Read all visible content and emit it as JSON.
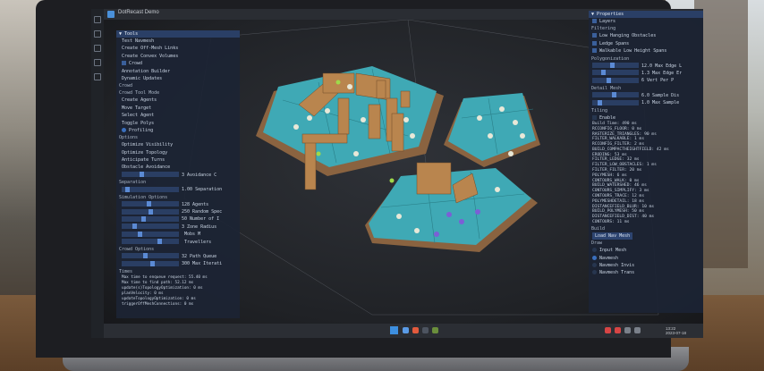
{
  "app": {
    "title": "DotRecast Demo"
  },
  "tools_panel": {
    "header": "Tools",
    "items": [
      {
        "label": "Test Navmesh",
        "kind": "text"
      },
      {
        "label": "Create Off-Mesh Links",
        "kind": "text"
      },
      {
        "label": "Create Convex Volumes",
        "kind": "text"
      },
      {
        "label": "Crowd",
        "kind": "check"
      },
      {
        "label": "Annotation Builder",
        "kind": "text"
      },
      {
        "label": "Dynamic Updates",
        "kind": "text"
      }
    ],
    "crowd_section": "Crowd",
    "crowd_tool_mode": "Crowd Tool Mode",
    "modes": [
      "Create Agents",
      "Move Target",
      "Select Agent",
      "Toggle Polys",
      "Profiling"
    ],
    "options_label": "Options",
    "options": [
      "Optimize Visibility",
      "Optimize Topology",
      "Anticipate Turns",
      "Obstacle Avoidance"
    ],
    "avoidance": {
      "value": "3",
      "label": "Avoidance C"
    },
    "separation_label": "Separation",
    "separation": {
      "value": "1.00",
      "label": "Separation"
    },
    "sim_label": "Simulation Options",
    "sim_rows": [
      {
        "value": "128",
        "label": "Agents"
      },
      {
        "value": "250",
        "label": "Random Spec"
      },
      {
        "value": "50",
        "label": "Number of I"
      },
      {
        "value": "3",
        "label": "Zone Radius"
      },
      {
        "value": "",
        "label": "Mobs M"
      },
      {
        "value": "",
        "label": "Travellers"
      }
    ],
    "crowd_opts_label": "Crowd Options",
    "crowd_opts": [
      {
        "value": "32",
        "label": "Path Queue"
      },
      {
        "value": "300",
        "label": "Max Iterati"
      }
    ],
    "times_label": "Times",
    "times": [
      "Max time to enqueue request: 55.40 ms",
      "Max time to find path: 52.12 ms",
      "update(s)TopologyOptimization: 0 ms",
      "planVelocity: 0 ms",
      "updateTopologyOptimization: 0 ms",
      "triggerOffMeshConnections: 0 ms"
    ]
  },
  "properties_panel": {
    "header": "Properties",
    "top_check": "Layers",
    "filtering_label": "Filtering",
    "filtering": [
      "Low Hanging Obstacles",
      "Ledge Spans",
      "Walkable Low Height Spans"
    ],
    "poly_label": "Polygonization",
    "poly_rows": [
      {
        "value": "12.0",
        "label": "Max Edge L"
      },
      {
        "value": "1.3",
        "label": "Max Edge Er"
      },
      {
        "value": "6",
        "label": "Vert Per P"
      }
    ],
    "detail_label": "Detail Mesh",
    "detail_rows": [
      {
        "value": "6.0",
        "label": "Sample Dis"
      },
      {
        "value": "1.0",
        "label": "Max Sample"
      }
    ],
    "tiling_label": "Tiling",
    "tiling_enable": "Enable",
    "stats": [
      "Build Time: 490 ms",
      "RCCONFIG_FLOOR: 0 ms",
      "RASTERIZE_TRIANGLES: 90 ms",
      "FILTER_WALKABLE: 1 ms",
      "RCCONFIG_FILTER: 2 ms",
      "BUILD_COMPACTHEIGHTFIELD: 42 ms",
      "ERODING: 53 ms",
      "FILTER_LEDGE: 32 ms",
      "FILTER_LOW_OBSTACLES: 1 ms",
      "FILTER_FILTER: 20 ms",
      "POLYMESH: 6 ms",
      "CONTOURS_WALK: 0 ms",
      "BUILD_WATERSHED: 46 ms",
      "CONTOURS_SIMPLIFY: 3 ms",
      "CONTOURS_TRACE: 12 ms",
      "POLYMESHDETAIL: 18 ms",
      "DISTANCEFIELD_BLUR: 10 ms",
      "BUILD_POLYMESH: 50 ms",
      "DISTANCEFIELD_DIST: 40 ms",
      "CONTOURS: 11 ms"
    ],
    "build_label": "Build",
    "load_button": "Load Nav Mesh",
    "draw_label": "Draw",
    "draw_options": [
      {
        "label": "Input Mesh",
        "selected": false
      },
      {
        "label": "Navmesh",
        "selected": true
      },
      {
        "label": "Navmesh Invis",
        "selected": false
      },
      {
        "label": "Navmesh Trans",
        "selected": false
      }
    ]
  },
  "taskbar": {
    "time": "13:22",
    "date": "2023-07-18"
  },
  "colors": {
    "panel": "#1c2434",
    "navmesh": "#3fa9b5",
    "wall": "#b9854e",
    "agent": "#e8e8d8",
    "agent_alt": "#7b5fd6",
    "agent_green": "#9fd94a"
  }
}
